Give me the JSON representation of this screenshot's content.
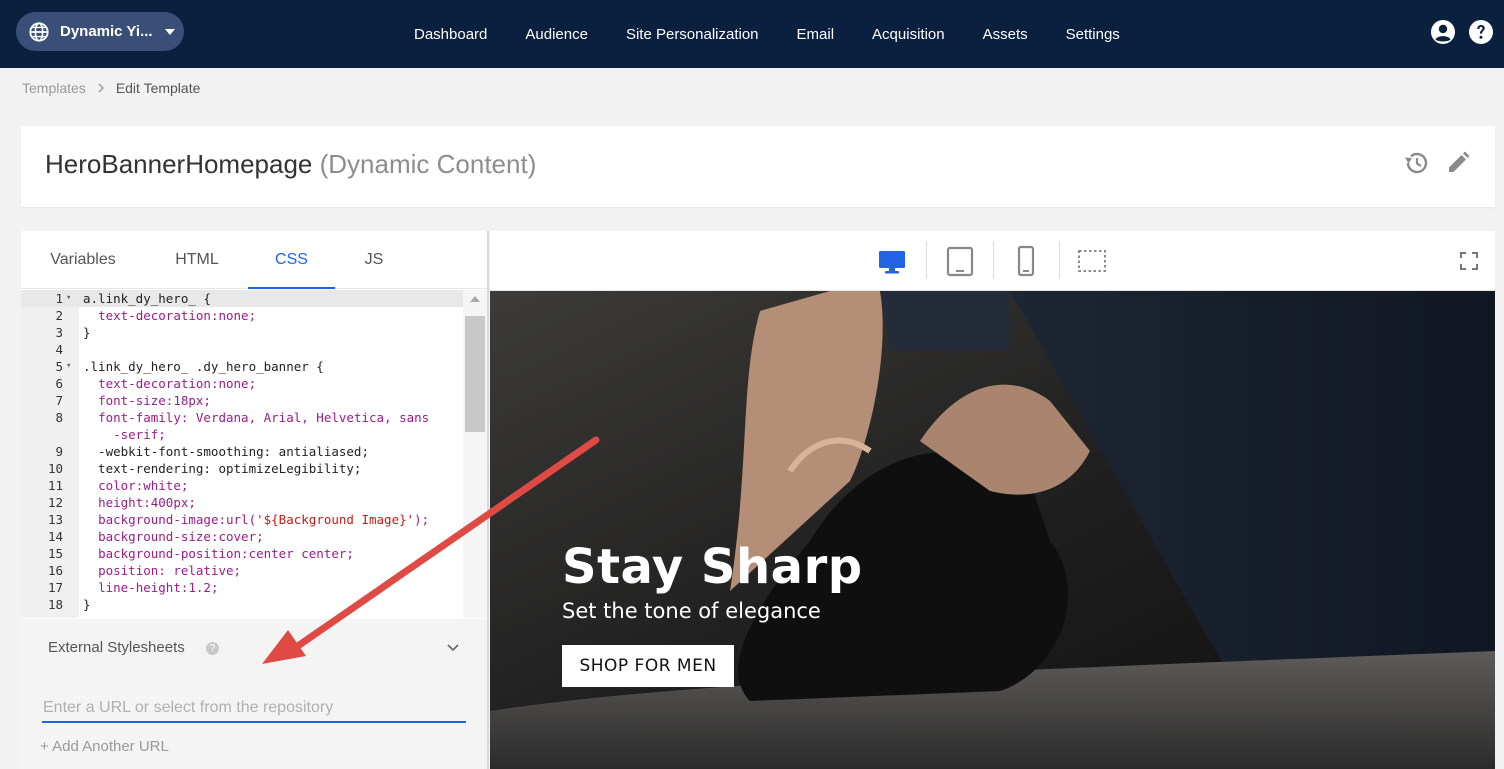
{
  "topbar": {
    "site_name": "Dynamic Yi...",
    "nav": [
      "Dashboard",
      "Audience",
      "Site Personalization",
      "Email",
      "Acquisition",
      "Assets",
      "Settings"
    ],
    "icons": [
      "globe-icon",
      "user-icon",
      "help-icon"
    ]
  },
  "breadcrumb": {
    "parent": "Templates",
    "current": "Edit Template"
  },
  "template": {
    "name": "HeroBannerHomepage",
    "type": "(Dynamic Content)"
  },
  "editor": {
    "tabs": [
      "Variables",
      "HTML",
      "CSS",
      "JS"
    ],
    "active_tab": "CSS",
    "code_lines": [
      {
        "n": "1",
        "fold": true,
        "text": "a.link_dy_hero_ {"
      },
      {
        "n": "2",
        "fold": false,
        "text": "  text-decoration:none;"
      },
      {
        "n": "3",
        "fold": false,
        "text": "}"
      },
      {
        "n": "4",
        "fold": false,
        "text": ""
      },
      {
        "n": "5",
        "fold": true,
        "text": ".link_dy_hero_ .dy_hero_banner {"
      },
      {
        "n": "6",
        "fold": false,
        "text": "  text-decoration:none;"
      },
      {
        "n": "7",
        "fold": false,
        "text": "  font-size:18px;"
      },
      {
        "n": "8",
        "fold": false,
        "text": "  font-family: Verdana, Arial, Helvetica, sans"
      },
      {
        "n": "",
        "fold": false,
        "text": "    -serif;"
      },
      {
        "n": "9",
        "fold": false,
        "text": "  -webkit-font-smoothing: antialiased;"
      },
      {
        "n": "10",
        "fold": false,
        "text": "  text-rendering: optimizeLegibility;"
      },
      {
        "n": "11",
        "fold": false,
        "text": "  color:white;"
      },
      {
        "n": "12",
        "fold": false,
        "text": "  height:400px;"
      },
      {
        "n": "13",
        "fold": false,
        "text": "  background-image:url('${Background Image}');"
      },
      {
        "n": "14",
        "fold": false,
        "text": "  background-size:cover;"
      },
      {
        "n": "15",
        "fold": false,
        "text": "  background-position:center center;"
      },
      {
        "n": "16",
        "fold": false,
        "text": "  position: relative;"
      },
      {
        "n": "17",
        "fold": false,
        "text": "  line-height:1.2;"
      },
      {
        "n": "18",
        "fold": false,
        "text": "}"
      }
    ],
    "external_stylesheets": {
      "label": "External Stylesheets",
      "help": "?",
      "input_placeholder": "Enter a URL or select from the repository",
      "input_value": "",
      "add_link": "+ Add Another URL"
    }
  },
  "preview": {
    "devices": [
      "desktop-icon",
      "tablet-icon",
      "mobile-icon",
      "custom-size-icon"
    ],
    "active_device": "desktop-icon",
    "banner": {
      "title": "Stay Sharp",
      "subtitle": "Set the tone of elegance",
      "cta": "SHOP FOR MEN"
    }
  },
  "colors": {
    "topbar": "#0b1f3f",
    "accent": "#2063e6",
    "annotation_arrow": "#e04a44"
  }
}
